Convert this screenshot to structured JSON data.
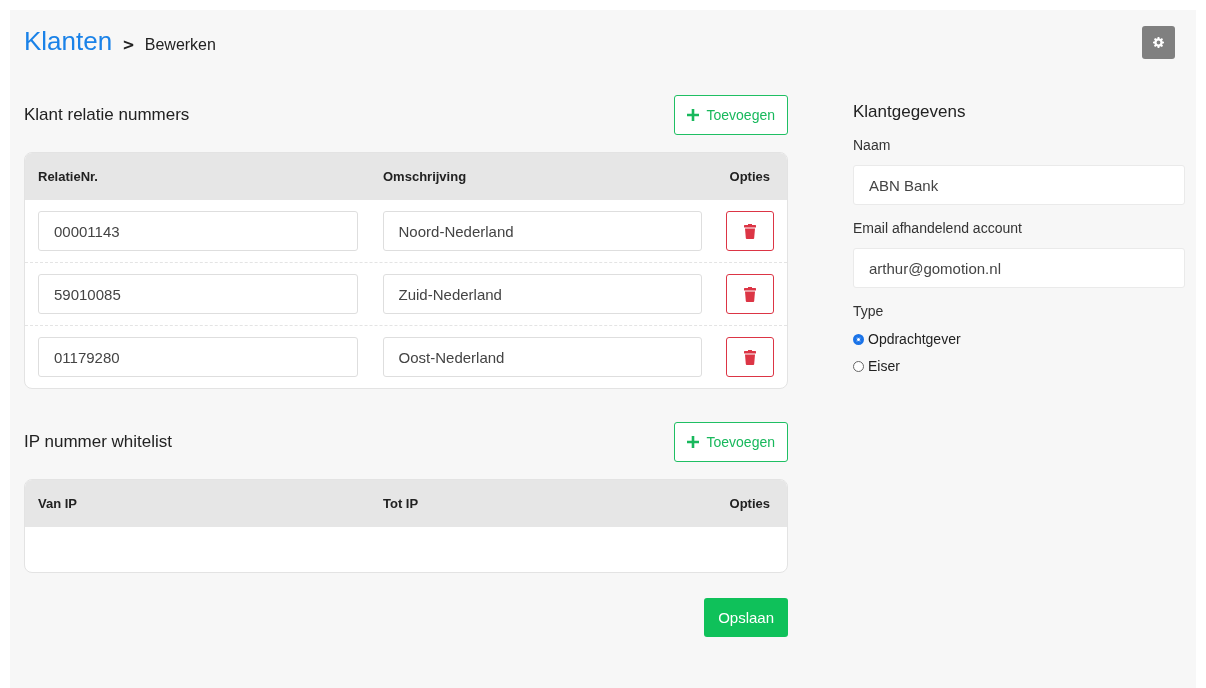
{
  "breadcrumb": {
    "title": "Klanten",
    "separator": ">",
    "current": "Bewerken"
  },
  "relations": {
    "title": "Klant relatie nummers",
    "add_button": "Toevoegen",
    "columns": [
      "RelatieNr.",
      "Omschrijving",
      "Opties"
    ],
    "rows": [
      {
        "number": "00001143",
        "description": "Noord-Nederland"
      },
      {
        "number": "59010085",
        "description": "Zuid-Nederland"
      },
      {
        "number": "01179280",
        "description": "Oost-Nederland"
      }
    ]
  },
  "whitelist": {
    "title": "IP nummer whitelist",
    "add_button": "Toevoegen",
    "columns": [
      "Van IP",
      "Tot IP",
      "Opties"
    ]
  },
  "save_button": "Opslaan",
  "customer": {
    "title": "Klantgegevens",
    "fields": [
      {
        "label": "Naam",
        "value": "ABN Bank"
      },
      {
        "label": "Email afhandelend account",
        "value": "arthur@gomotion.nl"
      }
    ],
    "type_label": "Type",
    "types": [
      {
        "label": "Opdrachtgever",
        "selected": true
      },
      {
        "label": "Eiser",
        "selected": false
      }
    ]
  }
}
